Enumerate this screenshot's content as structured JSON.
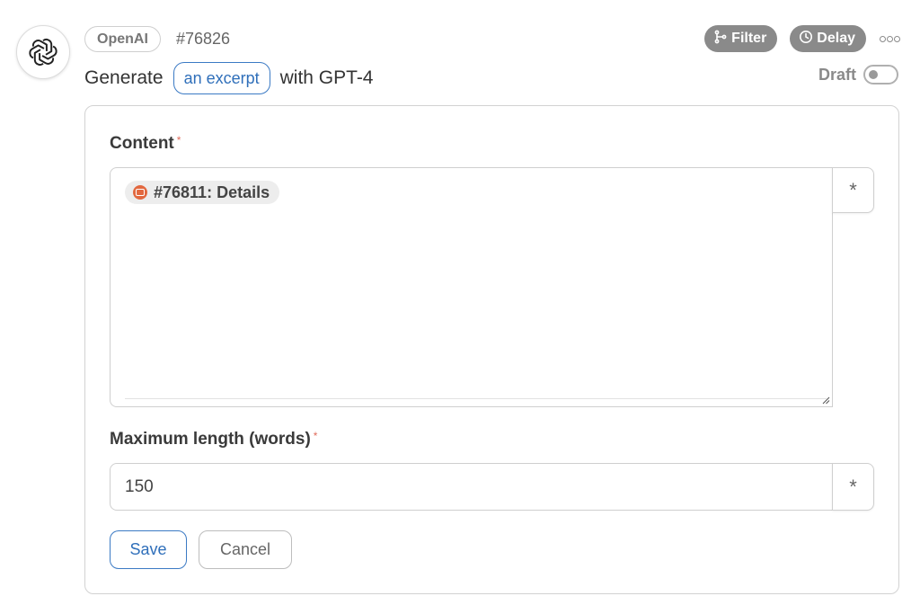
{
  "header": {
    "provider": "OpenAI",
    "step_id": "#76826",
    "actions": {
      "filter_label": "Filter",
      "delay_label": "Delay"
    },
    "title_prefix": "Generate",
    "title_highlight": "an excerpt",
    "title_suffix": "with GPT-4",
    "draft_label": "Draft"
  },
  "form": {
    "content": {
      "label": "Content",
      "required_mark": "*",
      "token_label": "#76811: Details"
    },
    "max_length": {
      "label": "Maximum length (words)",
      "required_mark": "*",
      "value": "150"
    },
    "variable_button_glyph": "*",
    "save_label": "Save",
    "cancel_label": "Cancel"
  },
  "icons": {
    "logo": "openai-logo-icon",
    "filter": "branch-filter-icon",
    "delay": "clock-icon",
    "more": "more-dots-icon",
    "token": "step-token-icon"
  },
  "colors": {
    "accent": "#3b7ac4",
    "pill_gray": "#8a8a8a",
    "required": "#e06b5b",
    "token_icon": "#e2683f"
  }
}
